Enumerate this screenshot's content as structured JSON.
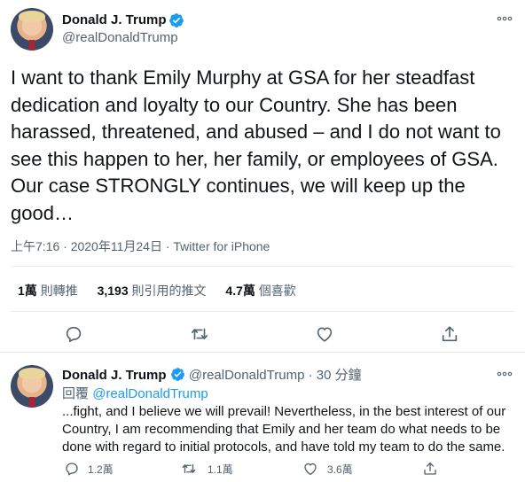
{
  "main_tweet": {
    "author_name": "Donald J. Trump",
    "author_handle": "@realDonaldTrump",
    "text": "I want to thank Emily Murphy at GSA for her steadfast dedication and loyalty to our Country. She has been harassed, threatened, and abused – and I do not want to see this happen to her, her family, or employees of GSA. Our case STRONGLY continues, we will keep up the good…",
    "time": "上午7:16",
    "date": "2020年11月24日",
    "separator": "·",
    "source": "Twitter for iPhone",
    "stats": {
      "retweets_num": "1萬",
      "retweets_label": "則轉推",
      "quotes_num": "3,193",
      "quotes_label": "則引用的推文",
      "likes_num": "4.7萬",
      "likes_label": "個喜歡"
    }
  },
  "reply_tweet": {
    "author_name": "Donald J. Trump",
    "author_handle": "@realDonaldTrump",
    "dot": "·",
    "time_ago": "30 分鐘",
    "reply_prefix": "回覆",
    "reply_to": "@realDonaldTrump",
    "text": "...fight, and I believe we will prevail! Nevertheless, in the best interest of our Country, I am recommending that Emily and her team do what needs to be done with regard to initial protocols, and have told my team to do the same.",
    "reply_count": "1.2萬",
    "retweet_count": "1.1萬",
    "like_count": "3.6萬"
  },
  "colors": {
    "accent": "#1d9bf0",
    "secondary_text": "#536471",
    "divider": "#e6ecf0"
  },
  "icons": [
    "verified-badge-icon",
    "more-icon",
    "reply-icon",
    "retweet-icon",
    "like-icon",
    "share-icon"
  ]
}
